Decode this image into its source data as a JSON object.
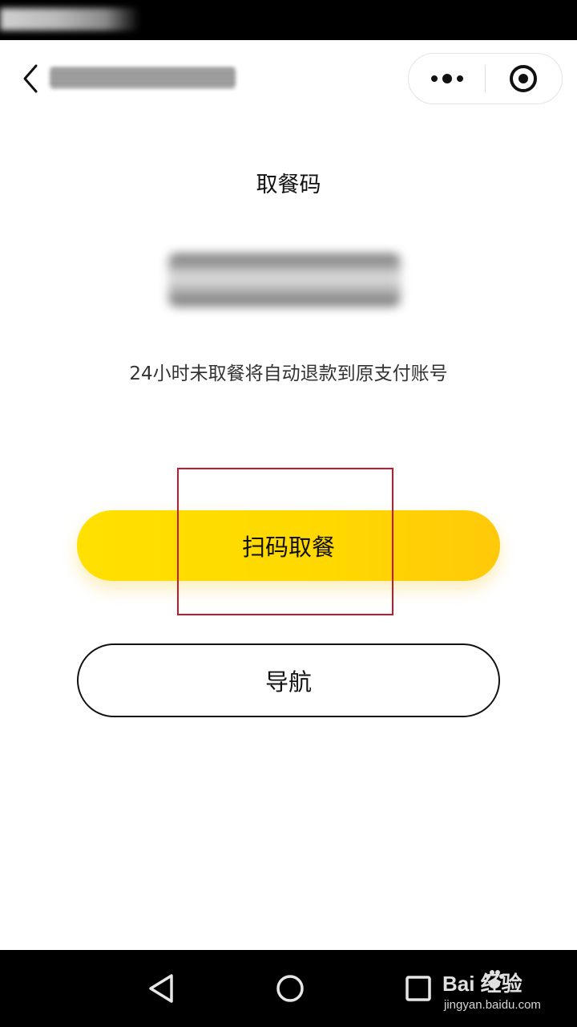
{
  "status_bar": {
    "text": ""
  },
  "nav_bar": {
    "title": "",
    "back_icon": "chevron-left-icon",
    "more_icon": "more-dots-icon",
    "close_icon": "target-close-icon"
  },
  "content": {
    "label": "取餐码",
    "pickup_code": "",
    "refund_note": "24小时未取餐将自动退款到原支付账号"
  },
  "buttons": {
    "scan_pickup": "扫码取餐",
    "navigate": "导航"
  },
  "colors": {
    "primary_yellow": "#FFDA00",
    "highlight_red": "#C3192B",
    "text": "#111111"
  },
  "system_nav": {
    "back_icon": "triangle-back-icon",
    "home_icon": "circle-home-icon",
    "recent_icon": "square-recent-icon"
  },
  "watermark": {
    "brand": "Bai  经验",
    "url": "jingyan.baidu.com"
  }
}
